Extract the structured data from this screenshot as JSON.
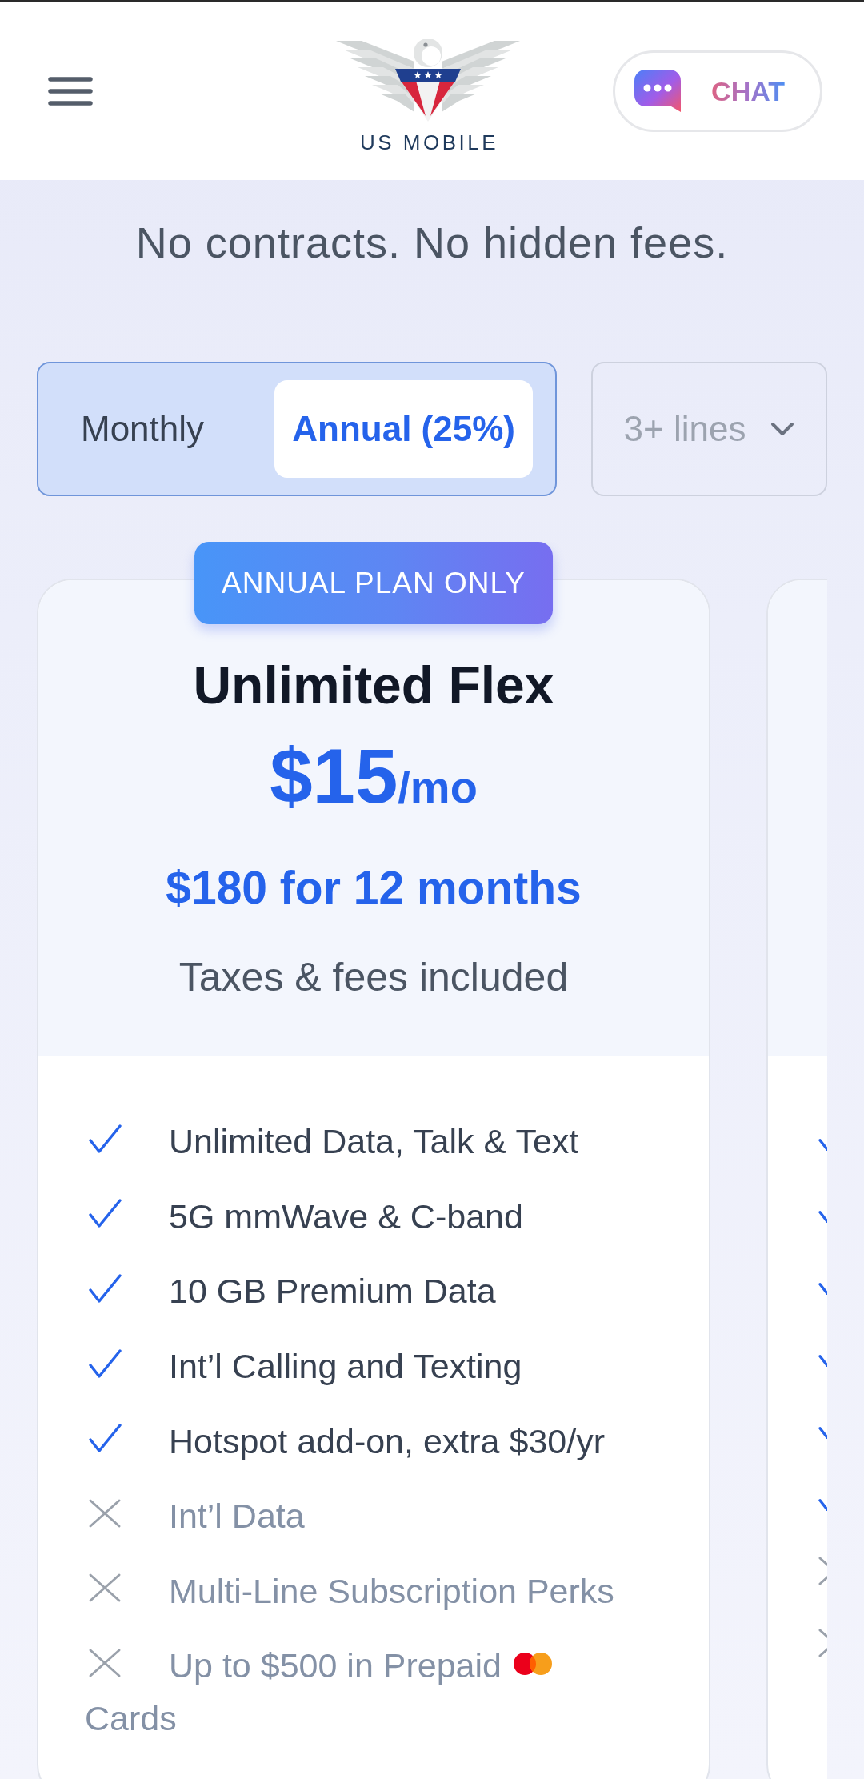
{
  "header": {
    "logo_text": "US MOBILE",
    "chat_button": {
      "label": "CHAT"
    }
  },
  "tagline": "No contracts. No hidden fees.",
  "billing_toggle": [
    {
      "label": "Monthly",
      "selected": false
    },
    {
      "label": "Annual (25%)",
      "selected": true
    }
  ],
  "lines_dropdown": {
    "value": "3+ lines"
  },
  "plans": [
    {
      "badge": "ANNUAL PLAN ONLY",
      "name": "Unlimited Flex",
      "price": "$15",
      "price_unit": "/mo",
      "annual_total": "$180 for 12 months",
      "note": "Taxes & fees included",
      "features": [
        {
          "kind": "plain",
          "text": "Unlimited Data, Talk & Text",
          "included": true
        },
        {
          "kind": "plain",
          "text": "5G mmWave & C-band",
          "included": true
        },
        {
          "kind": "plain",
          "text": "10 GB Premium Data",
          "included": true
        },
        {
          "kind": "plain",
          "text": "Int’l Calling and Texting",
          "included": true
        },
        {
          "kind": "plain",
          "text": "Hotspot add-on, extra $30/yr",
          "included": true
        },
        {
          "kind": "plain",
          "text": "Int’l Data",
          "included": false
        },
        {
          "kind": "plain",
          "text": "Multi-Line Subscription Perks",
          "included": false
        },
        {
          "kind": "card-perk",
          "text": "Up to $500 in Prepaid",
          "text_after": "Cards",
          "included": false
        }
      ]
    },
    {
      "features": [
        {
          "kind": "plain",
          "included": true
        },
        {
          "kind": "plain",
          "included": true
        },
        {
          "kind": "plain",
          "included": true
        },
        {
          "kind": "plain",
          "included": true
        },
        {
          "kind": "plain",
          "included": true
        },
        {
          "kind": "plain",
          "included": true
        },
        {
          "kind": "plain",
          "included": false
        },
        {
          "kind": "plain",
          "included": false
        }
      ]
    }
  ]
}
